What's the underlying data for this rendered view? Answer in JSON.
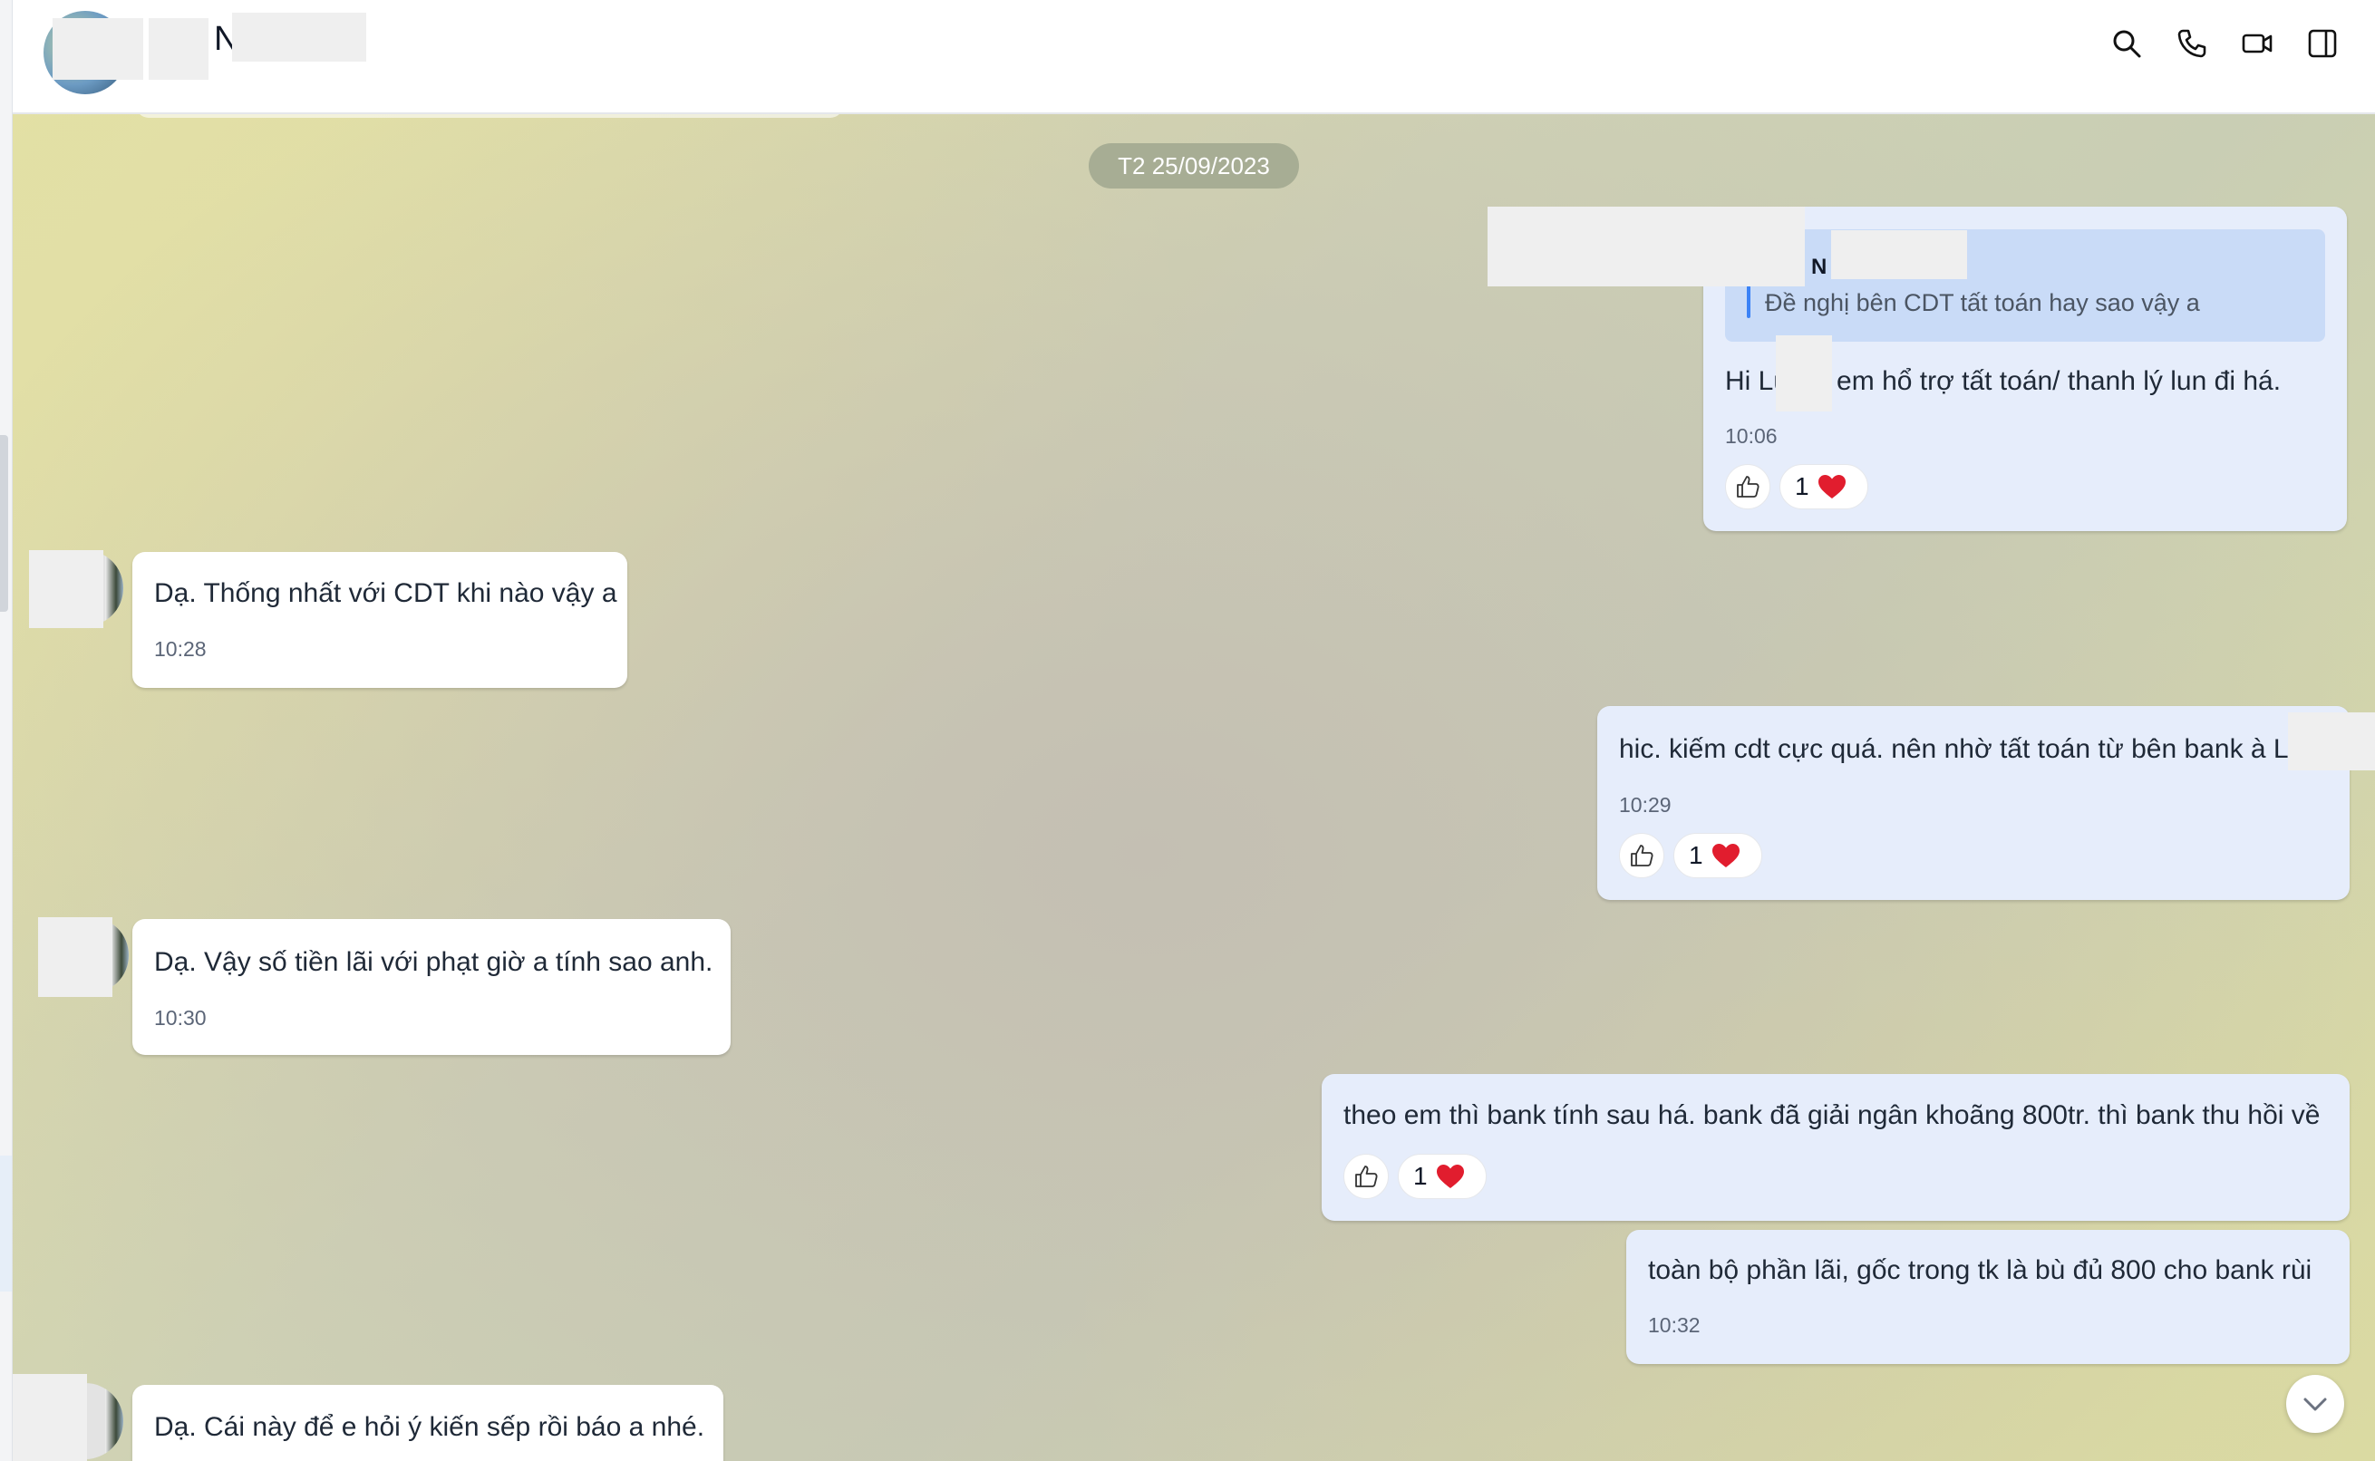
{
  "header": {
    "contact_name": "N",
    "icons": [
      "search-icon",
      "phone-icon",
      "video-icon",
      "panel-toggle-icon"
    ]
  },
  "chat": {
    "date_separator": "T2 25/09/2023",
    "messages": [
      {
        "direction": "out",
        "quote_name": "N",
        "quote_text": "Đề nghị bên CDT tất toán hay sao vậy a",
        "text": "Hi Lu        hờ em hổ trợ tất toán/ thanh lý lun đi há.",
        "time": "10:06",
        "reaction_count": "1"
      },
      {
        "direction": "in",
        "text": "Dạ. Thống nhất với CDT khi nào vậy a",
        "time": "10:28"
      },
      {
        "direction": "out",
        "text": "hic. kiếm cdt cực quá. nên nhờ tất toán từ bên bank à Lu",
        "time": "10:29",
        "reaction_count": "1"
      },
      {
        "direction": "in",
        "text": "Dạ. Vậy số tiền lãi với phạt giờ a tính sao anh.",
        "time": "10:30"
      },
      {
        "direction": "out",
        "text": "theo em thì bank tính sau há. bank đã giải ngân khoãng 800tr. thì bank thu hồi về",
        "reaction_count": "1"
      },
      {
        "direction": "out",
        "text": "toàn bộ phần lãi, gốc trong tk là bù đủ 800 cho bank rùi",
        "time": "10:32"
      },
      {
        "direction": "in",
        "text": "Dạ. Cái này để e hỏi ý kiến sếp rồi báo a nhé."
      }
    ]
  },
  "icons": {
    "like": "thumbs-up-icon",
    "heart": "heart-icon",
    "scroll": "chevron-down-icon"
  },
  "colors": {
    "incoming_bubble": "#ffffff",
    "outgoing_bubble": "#e6edfb",
    "quote_bg": "#c9dbf7",
    "heart": "#e11d2e"
  }
}
